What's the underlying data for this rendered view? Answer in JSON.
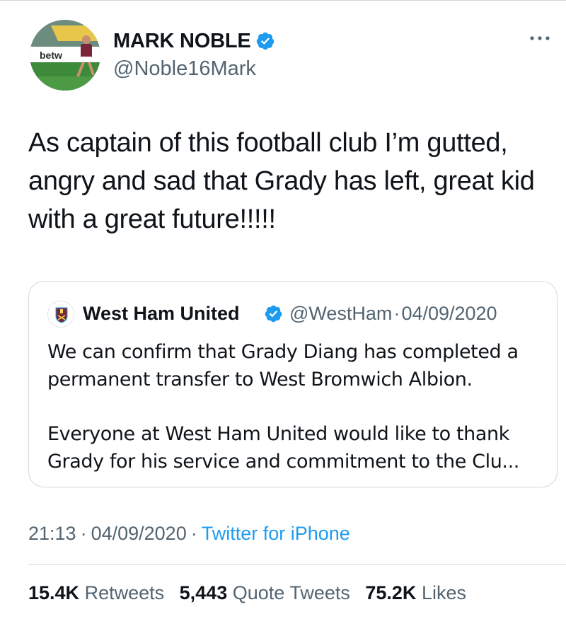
{
  "colors": {
    "text": "#0f1419",
    "secondary": "#536471",
    "link": "#1d9bf0",
    "verified": "#1d9bf0",
    "border": "#cfd9de"
  },
  "author": {
    "display_name": "MARK NOBLE",
    "handle": "@Noble16Mark",
    "verified": true,
    "avatar_icon": "profile-photo",
    "avatar_sponsor_text": "betw"
  },
  "more_icon": "ellipsis-icon",
  "tweet": {
    "text": "As captain of this football club I’m gutted, angry and sad that Grady has left, great kid with a great future!!!!!"
  },
  "quoted_tweet": {
    "avatar_icon": "west-ham-crest",
    "display_name": "West Ham United",
    "verified": true,
    "handle": "@WestHam",
    "separator": "·",
    "date": "04/09/2020",
    "paragraph_1": "We can confirm that Grady Diang has completed a permanent transfer to West Bromwich Albion.",
    "paragraph_2": "Everyone at West Ham United would like to thank Grady for his service and commitment to the Clu..."
  },
  "meta": {
    "time": "21:13",
    "separator": "·",
    "date": "04/09/2020",
    "source": "Twitter for iPhone"
  },
  "stats": {
    "retweets_count": "15.4K",
    "retweets_label": "Retweets",
    "quotes_count": "5,443",
    "quotes_label": "Quote Tweets",
    "likes_count": "75.2K",
    "likes_label": "Likes"
  }
}
